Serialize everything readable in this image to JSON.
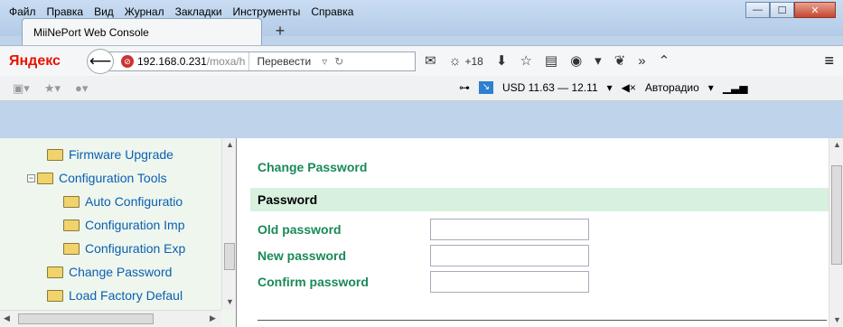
{
  "menu": [
    "Файл",
    "Правка",
    "Вид",
    "Журнал",
    "Закладки",
    "Инструменты",
    "Справка"
  ],
  "window_controls": {
    "minimize": "—",
    "maximize": "☐",
    "close": "✕"
  },
  "tab": {
    "title": "MiiNePort Web Console",
    "new_tab": "+"
  },
  "nav": {
    "yandex_logo": "Яндекс",
    "url_host": "192.168.0.231",
    "url_path": "/moxa/h",
    "translate": "Перевести",
    "weather": "+18"
  },
  "bookmarks": {
    "currency": "USD 11.63 — 12.11",
    "radio": "Авторадио"
  },
  "tree": {
    "items": [
      "Firmware Upgrade",
      "Configuration Tools",
      "Auto Configuratio",
      "Configuration Imp",
      "Configuration Exp",
      "Change Password",
      "Load Factory Defaul"
    ]
  },
  "form": {
    "page_title": "Change Password",
    "section": "Password",
    "old_label": "Old password",
    "new_label": "New password",
    "confirm_label": "Confirm password",
    "old_value": "",
    "new_value": "",
    "confirm_value": ""
  }
}
